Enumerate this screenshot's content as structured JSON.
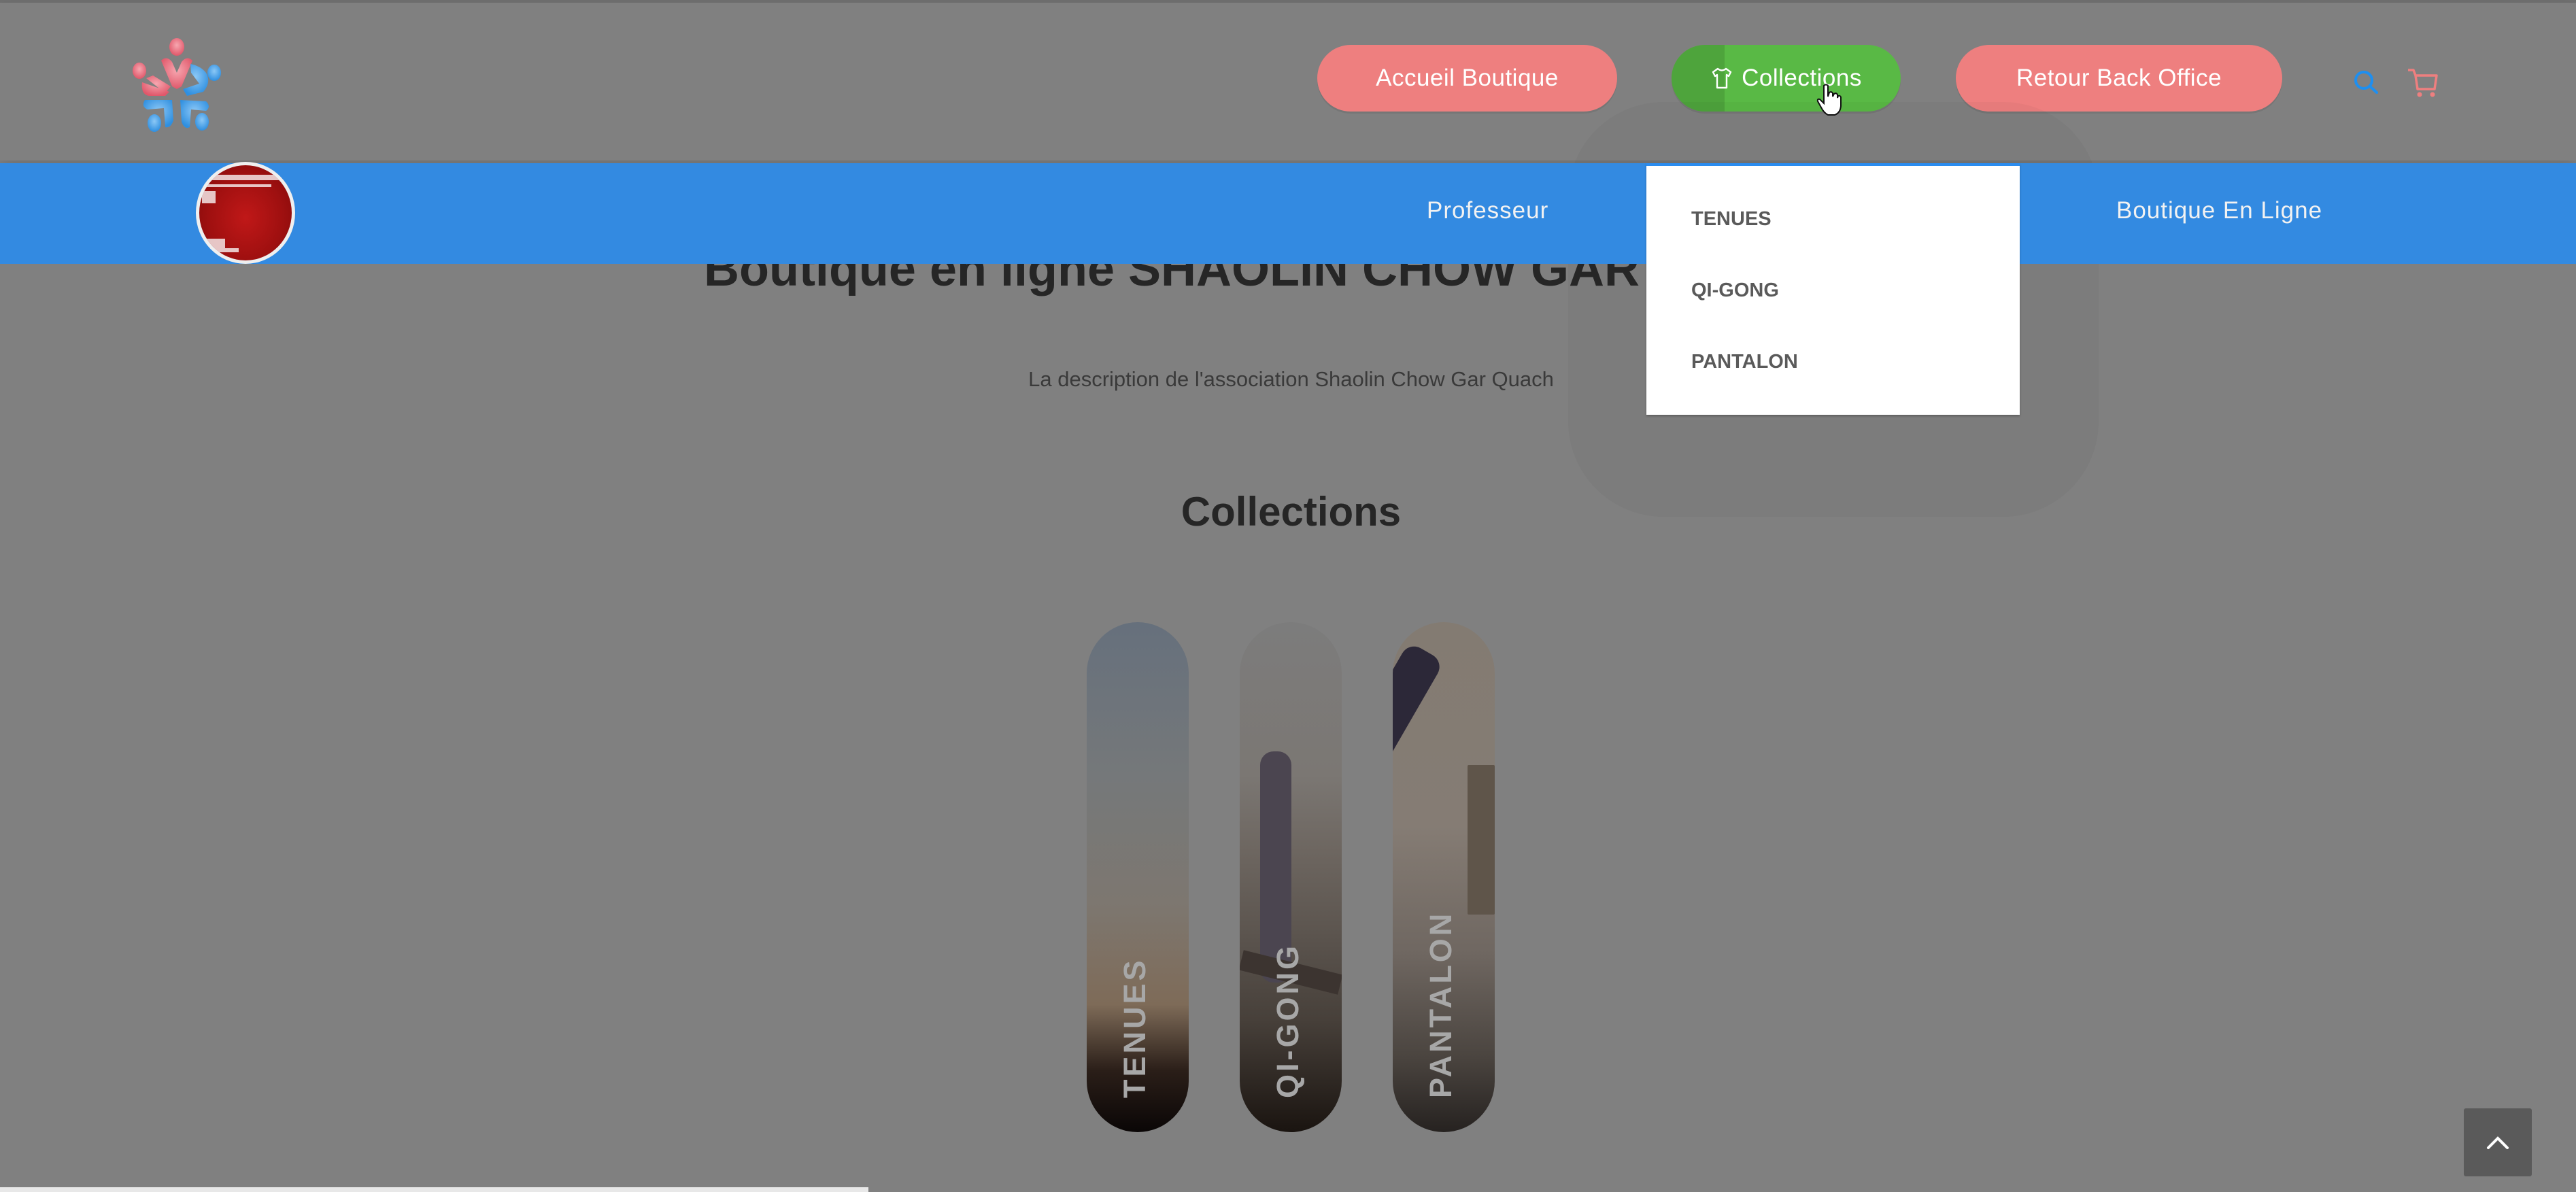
{
  "header": {
    "logo_icon": "people-circle-logo-icon",
    "buttons": [
      {
        "label": "Accueil Boutique",
        "color": "#ee7f7f"
      },
      {
        "label": "Collections",
        "icon": "tshirt-icon",
        "color": "#59b945",
        "state": "hovered"
      },
      {
        "label": "Retour Back Office",
        "color": "#ee7f7f"
      }
    ],
    "search_icon": "search-icon",
    "search_color": "#1e8ff0",
    "cart_icon": "cart-icon",
    "cart_color": "#ee7f7f"
  },
  "navbar": {
    "color": "#338ae1",
    "avatar_icon": "red-snow-avatar",
    "links": [
      {
        "label": "Professeur"
      },
      {
        "label": "Boutique En Ligne"
      }
    ]
  },
  "dropdown": {
    "items": [
      {
        "label": "TENUES"
      },
      {
        "label": "QI-GONG"
      },
      {
        "label": "PANTALON"
      }
    ]
  },
  "main": {
    "title": "Boutique en ligne SHAOLIN CHOW GAR QUACH",
    "description": "La description de l'association Shaolin Chow Gar Quach",
    "collections_heading": "Collections",
    "collections": [
      {
        "label": "TENUES"
      },
      {
        "label": "QI-GONG"
      },
      {
        "label": "PANTALON"
      }
    ]
  },
  "scroll_top_icon": "chevron-up-icon",
  "scroll_progress": 0.337
}
